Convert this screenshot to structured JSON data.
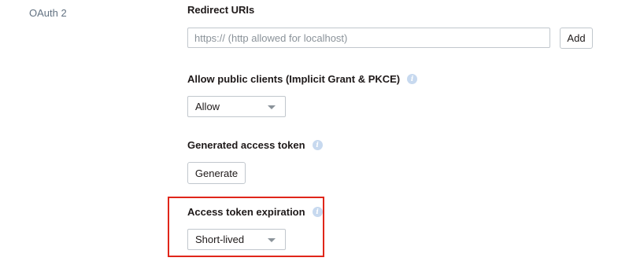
{
  "section": {
    "label": "OAuth 2"
  },
  "redirect_uris": {
    "title": "Redirect URIs",
    "placeholder": "https:// (http allowed for localhost)",
    "add_label": "Add"
  },
  "public_clients": {
    "title": "Allow public clients (Implicit Grant & PKCE)",
    "selected": "Allow"
  },
  "access_token": {
    "title": "Generated access token",
    "generate_label": "Generate"
  },
  "token_expiration": {
    "title": "Access token expiration",
    "selected": "Short-lived"
  },
  "icons": {
    "info": "info-icon",
    "dropdown": "chevron-down-icon"
  },
  "colors": {
    "highlight": "#e0261a",
    "info_icon": "#c7d9ef",
    "border": "#c1c7cd",
    "muted_text": "#637282"
  }
}
